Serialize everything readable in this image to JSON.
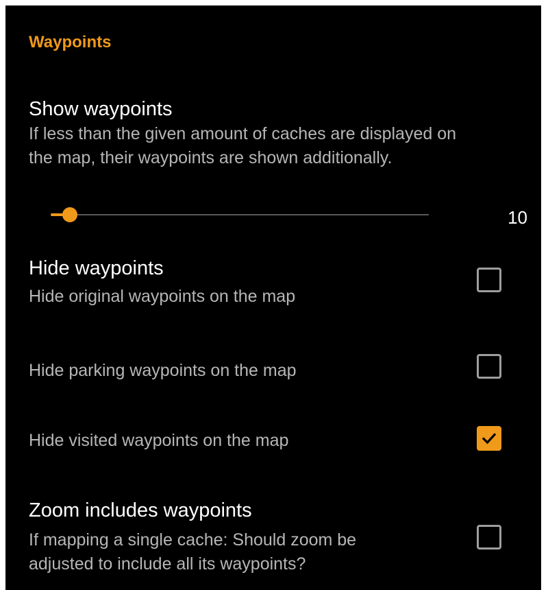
{
  "section": {
    "title": "Waypoints"
  },
  "show_waypoints": {
    "title": "Show waypoints",
    "summary_line1": "If less than the given amount of caches are displayed on",
    "summary_line2": "the map, their waypoints are shown additionally.",
    "value": "10",
    "slider_fraction": 0.05
  },
  "hide_waypoints": {
    "title": "Hide waypoints",
    "summary": "Hide original waypoints on the map",
    "checked": false
  },
  "hide_parking": {
    "summary": "Hide parking waypoints on the map",
    "checked": false
  },
  "hide_visited": {
    "summary": "Hide visited waypoints on the map",
    "checked": true
  },
  "zoom_includes": {
    "title": "Zoom includes waypoints",
    "summary_line1": "If mapping a single cache: Should zoom be",
    "summary_line2": "adjusted to include all its waypoints?",
    "checked": false
  },
  "colors": {
    "accent": "#ef9a1b",
    "background": "#000000",
    "text_primary": "#ffffff",
    "text_secondary": "#b6b6b6"
  },
  "icons": {
    "checkmark": "check-icon"
  }
}
